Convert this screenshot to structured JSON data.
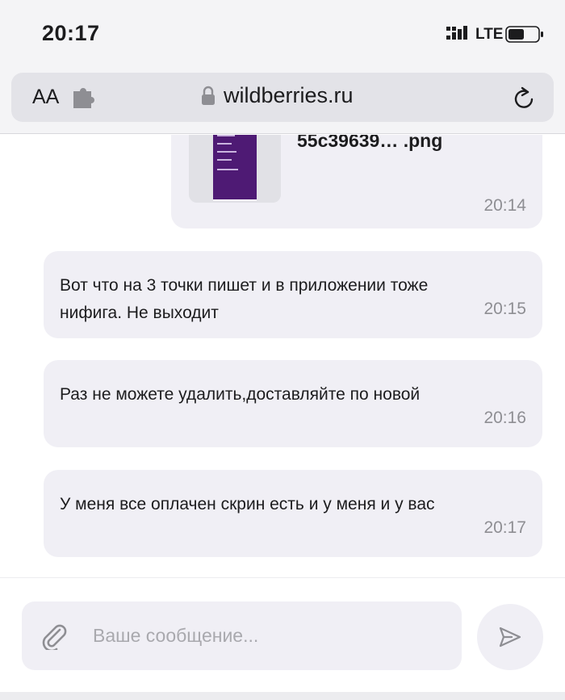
{
  "status_bar": {
    "time": "20:17",
    "network": "LTE",
    "icons": [
      "signal-icon",
      "battery-icon"
    ]
  },
  "browser": {
    "text_size_label": "AA",
    "domain": "wildberries.ru",
    "icons": [
      "extension-icon",
      "lock-icon",
      "reload-icon"
    ]
  },
  "chat": {
    "attachment": {
      "file_name": "55c39639…  .png",
      "time": "20:14"
    },
    "messages": [
      {
        "text": "Вот что на 3 точки пишет и в приложении тоже нифига. Не выходит",
        "time": "20:15"
      },
      {
        "text": "Раз не можете удалить,доставляйте по новой",
        "time": "20:16"
      },
      {
        "text": "У меня все оплачен скрин есть и у меня и у вас",
        "time": "20:17"
      }
    ]
  },
  "composer": {
    "placeholder": "Ваше сообщение...",
    "value": "",
    "icons": [
      "paperclip-icon",
      "send-icon"
    ]
  },
  "colors": {
    "bubble": "#f0eff5",
    "meta_text": "#8e8e93",
    "placeholder": "#a9a9ae",
    "bar_background": "#f4f4f6"
  }
}
